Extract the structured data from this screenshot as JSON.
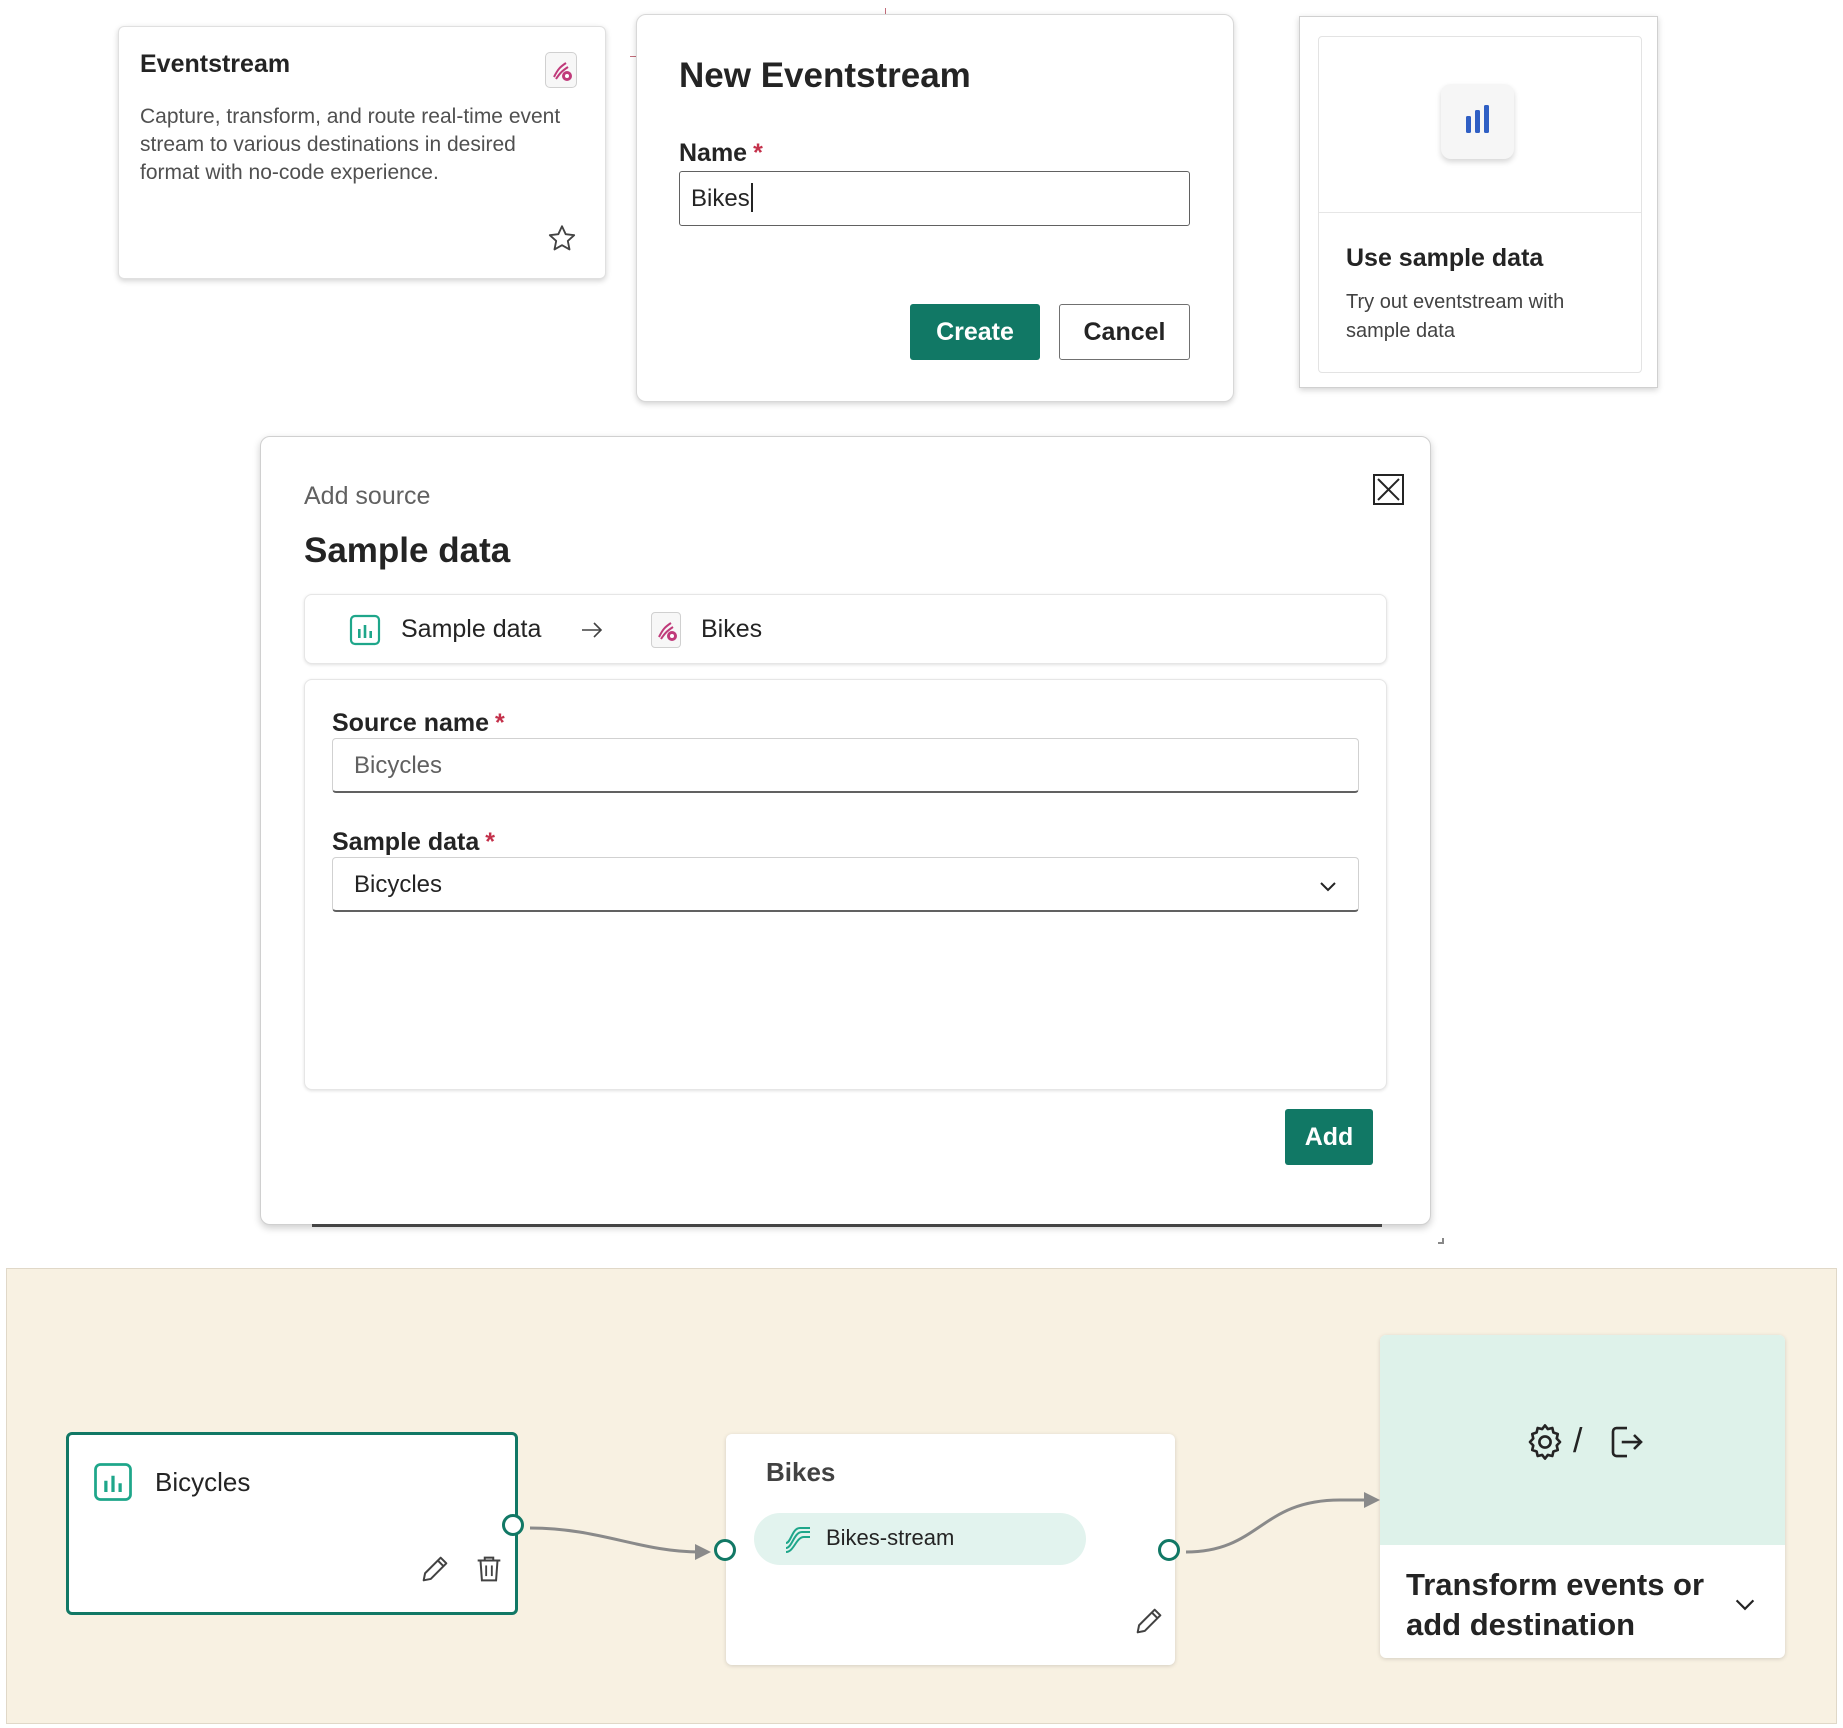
{
  "eventstream_card": {
    "title": "Eventstream",
    "description": "Capture, transform, and route real-time event stream to various destinations in desired format with no-code experience.",
    "icon": "eventstream-icon",
    "favorite_icon": "star-icon"
  },
  "new_eventstream_dialog": {
    "title": "New Eventstream",
    "name_label": "Name",
    "required_mark": "*",
    "name_value": "Bikes",
    "create_label": "Create",
    "cancel_label": "Cancel"
  },
  "sample_data_card": {
    "icon": "bar-chart-icon",
    "title": "Use sample data",
    "description": "Try out eventstream with sample data"
  },
  "add_source_panel": {
    "subtitle": "Add source",
    "title": "Sample data",
    "flow": {
      "source_label": "Sample data",
      "destination_label": "Bikes"
    },
    "source_name_label": "Source name",
    "source_name_value": "Bicycles",
    "sample_data_label": "Sample data",
    "sample_data_value": "Bicycles",
    "required_mark": "*",
    "add_label": "Add"
  },
  "canvas": {
    "source_node": {
      "label": "Bicycles"
    },
    "stream_node": {
      "title": "Bikes",
      "stream_label": "Bikes-stream"
    },
    "destination_node": {
      "label": "Transform events or add destination",
      "divider": "/"
    }
  },
  "colors": {
    "accent": "#117865",
    "required": "#c4314b",
    "canvas_bg": "#f8f1e2",
    "stream_pill": "#e2f3ee",
    "destination_header": "#def2ea",
    "eventstream_icon": "#c03a7a",
    "chart_icon": "#2f5fc4"
  }
}
